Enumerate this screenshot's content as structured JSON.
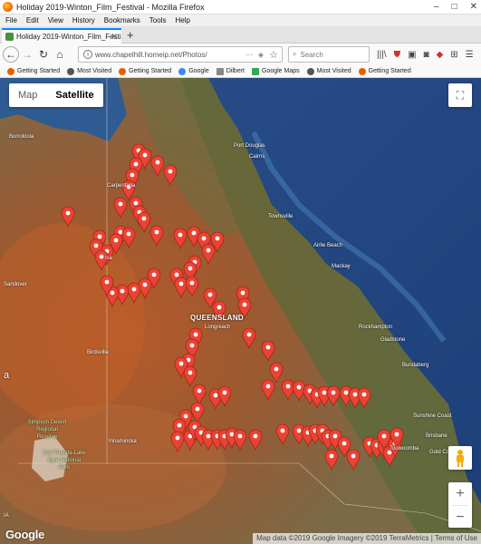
{
  "window": {
    "title": "Holiday 2019-Winton_Film_Festival - Mozilla Firefox",
    "min": "–",
    "max": "□",
    "close": "✕"
  },
  "menu": [
    "File",
    "Edit",
    "View",
    "History",
    "Bookmarks",
    "Tools",
    "Help"
  ],
  "tab": {
    "title": "Holiday 2019-Winton_Film_Festi",
    "close": "✕",
    "new_tab": "+"
  },
  "nav": {
    "back": "←",
    "forward": "→",
    "reload": "↻",
    "home": "⌂",
    "url": "www.chapelhill.homeip.net/Photos/",
    "url_more": "···",
    "star": "☆",
    "search_placeholder": "Search",
    "library": "|||\\",
    "menu": "☰"
  },
  "bookmarks": [
    {
      "label": "Getting Started",
      "color": "#e66000"
    },
    {
      "label": "Most Visited",
      "color": "#555555"
    },
    {
      "label": "Getting Started",
      "color": "#e66000"
    },
    {
      "label": "Google",
      "color": "#4285f4"
    },
    {
      "label": "Dilbert",
      "color": "#888888"
    },
    {
      "label": "Google Maps",
      "color": "#34a853"
    },
    {
      "label": "Most Visited",
      "color": "#555555"
    },
    {
      "label": "Getting Started",
      "color": "#e66000"
    }
  ],
  "map": {
    "type_map": "Map",
    "type_satellite": "Satellite",
    "fullscreen": "⛶",
    "zoom_in": "+",
    "zoom_out": "−",
    "logo": "Google",
    "attribution": "Map data ©2019 Google Imagery ©2019 TerraMetrics | Terms of Use",
    "place_labels": [
      {
        "name": "Borroloola"
      },
      {
        "name": "Port Douglas"
      },
      {
        "name": "Cairns"
      },
      {
        "name": "Townsville"
      },
      {
        "name": "Airlie Beach"
      },
      {
        "name": "Mackay"
      },
      {
        "name": "Rockhampton"
      },
      {
        "name": "Gladstone"
      },
      {
        "name": "Bundaberg"
      },
      {
        "name": "Sunshine Coast"
      },
      {
        "name": "Brisbane"
      },
      {
        "name": "Gold Coast"
      },
      {
        "name": "Toowoomba"
      },
      {
        "name": "Longreach"
      },
      {
        "name": "QUEENSLAND"
      },
      {
        "name": "Innamincka"
      },
      {
        "name": "Birdsville"
      },
      {
        "name": "Sandover"
      },
      {
        "name": "Simpson Desert Regional Reserve"
      },
      {
        "name": "Kati Thanda-Lake Eyre National Park"
      },
      {
        "name": "Carpentaria"
      },
      {
        "name": "Isa"
      },
      {
        "name": "a"
      },
      {
        "name": "IA"
      }
    ],
    "marker_color": "#ea4335"
  }
}
